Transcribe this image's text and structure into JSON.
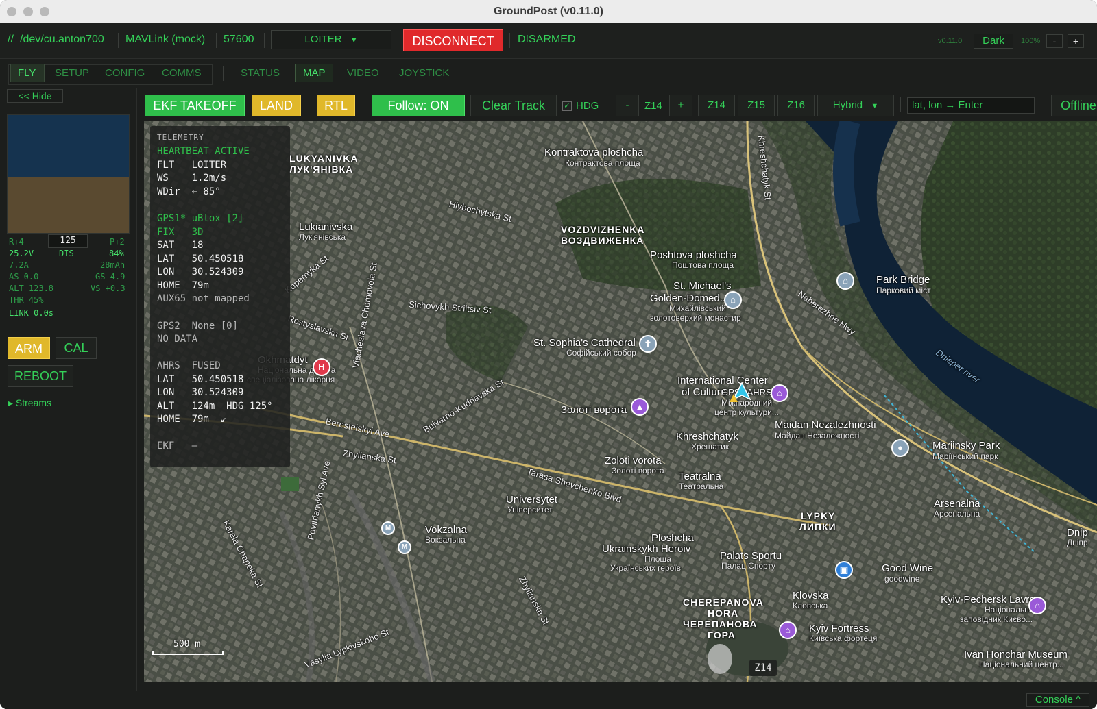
{
  "window": {
    "title": "GroundPost (v0.11.0)"
  },
  "connection": {
    "prefix": "//",
    "port": "/dev/cu.anton700",
    "protocol": "MAVLink (mock)",
    "baud": "57600",
    "flight_mode": "LOITER",
    "disconnect_label": "DISCONNECT",
    "arm_state": "DISARMED",
    "version": "v0.11.0",
    "theme": "Dark",
    "ui_zoom": "100%",
    "zoom_minus": "-",
    "zoom_plus": "+"
  },
  "tabs": {
    "primary": [
      "FLY",
      "SETUP",
      "CONFIG",
      "COMMS"
    ],
    "secondary": [
      "STATUS",
      "MAP",
      "VIDEO",
      "JOYSTICK"
    ],
    "active_primary": "FLY",
    "active_secondary": "MAP"
  },
  "left_panel": {
    "hide_label": "<< Hide",
    "roll": "R+4",
    "distance": "125",
    "pitch": "P+2",
    "voltage": "25.2V",
    "dis_label": "DIS",
    "battery_pct": "84%",
    "current": "7.2A",
    "consumed": "28mAh",
    "airspeed": "AS 0.0",
    "groundspeed": "GS 4.9",
    "altitude": "ALT 123.8",
    "vspeed": "VS +0.3",
    "throttle": "THR 45%",
    "link": "LINK  0.0s",
    "arm_label": "ARM",
    "cal_label": "CAL",
    "reboot_label": "REBOOT",
    "streams_label": "▸ Streams"
  },
  "toolbar": {
    "ekf_takeoff": "EKF TAKEOFF",
    "land": "LAND",
    "rtl": "RTL",
    "follow": "Follow: ON",
    "clear_track": "Clear Track",
    "hdg_label": "HDG",
    "hdg_checked": "✓",
    "zoom_minus": "-",
    "zoom_current": "Z14",
    "zoom_plus": "+",
    "z14": "Z14",
    "z15": "Z15",
    "z16": "Z16",
    "map_type": "Hybrid",
    "coord_placeholder": "lat, lon → Enter",
    "offline": "Offline"
  },
  "telemetry": {
    "header": "TELEMETRY",
    "heartbeat": "HEARTBEAT ACTIVE",
    "flt": "FLT   LOITER",
    "ws": "WS    1.2m/s",
    "wdir": "WDir  ← 85°",
    "gps1": "GPS1* uBlox [2]",
    "fix": "FIX   3D",
    "sat": "SAT   18",
    "lat": "LAT   50.450518",
    "lon": "LON   30.524309",
    "home": "HOME  79m",
    "aux": "AUX65 not mapped",
    "gps2": "GPS2  None [0]",
    "nodata": "NO DATA",
    "ahrs": "AHRS  FUSED",
    "ahrs_lat": "LAT   50.450518",
    "ahrs_lon": "LON   30.524309",
    "ahrs_alt": "ALT   124m  HDG 125°",
    "ahrs_home": "HOME  79m  ↙",
    "ekf": "EKF   –"
  },
  "map": {
    "scale": "500 m",
    "zoom_badge": "Z14",
    "labels": {
      "kontraktova": "Kontraktova ploshcha",
      "kontraktova_ua": "Контрактова площа",
      "vozdvyzhenka": "VOZDVIZHENKA",
      "vozdvyzhenka_ua": "ВОЗДВИЖЕНКА",
      "poshtova": "Poshtova ploshcha",
      "poshtova_ua": "Поштова площа",
      "park_bridge": "Park Bridge",
      "park_bridge_ua": "Парковий міст",
      "st_michael": "St. Michael's",
      "golden_domed": "Golden-Domed...",
      "st_michael_ua1": "Михайлівський",
      "st_michael_ua2": "золотоверхий монастир",
      "lukianivska": "Lukianivska",
      "lukianivska_ua": "Лук'янівська",
      "st_sophia": "St. Sophia's Cathedral",
      "st_sophia_ua": "Софійський собор",
      "okhmatdyt": "Okhmatdyt",
      "okhmatdyt_ua1": "Національна дитяча",
      "okhmatdyt_ua2": "спеціалізована лікарня",
      "intl_center1": "International Center",
      "intl_center2": "of Culture",
      "intl_center_ua1": "Міжнародний",
      "intl_center_ua2": "центр культури...",
      "zoloti_vorota_ua_big": "Золоті ворота",
      "maidan": "Maidan Nezalezhnosti",
      "maidan_ua": "Майдан Незалежності",
      "mariinsky": "Mariinsky Park",
      "mariinsky_ua": "Маріїнський парк",
      "khreshchatyk": "Khreshchatyk",
      "khreshchatyk_ua": "Хрещатик",
      "zoloti_vorota": "Zoloti vorota",
      "zoloti_vorota_ua": "Золоті ворота",
      "teatralna": "Teatralna",
      "teatralna_ua": "Театральна",
      "universytet": "Universytet",
      "universytet_ua": "Університет",
      "arsenalna": "Arsenalna",
      "arsenalna_ua": "Арсенальна",
      "lypky": "LYPKY",
      "lypky_ua": "ЛИПКИ",
      "vokzalna": "Vokzalna",
      "vokzalna_ua": "Вокзальна",
      "ploshcha": "Ploshcha",
      "ukrainskykh": "Ukrainskykh Heroiv",
      "ukrainskykh_ua1": "Площа",
      "ukrainskykh_ua2": "Українських героїв",
      "palats_sportu": "Palats Sportu",
      "palats_sportu_ua": "Палац Спорту",
      "good_wine": "Good Wine",
      "good_wine_sub": "goodwine",
      "klovska": "Klovska",
      "klovska_ua": "Кловська",
      "kyiv_pechersk": "Kyiv-Pechersk Lavra",
      "kyiv_pechersk_ua1": "Національний",
      "kyiv_pechersk_ua2": "заповідник Києво...",
      "cherepanova": "CHEREPANOVA",
      "hora": "HORA",
      "cherepanova_ua": "ЧЕРЕПАНОВА",
      "hora_ua": "ГОРА",
      "kyiv_fortress": "Kyiv Fortress",
      "kyiv_fortress_ua": "Київська фортеця",
      "ivan_honchar": "Ivan Honchar Museum",
      "ivan_honchar_ua": "Національний центр...",
      "dnieper": "Dnieper river",
      "dnip": "Dnip",
      "dnip_ua": "Дніпр",
      "hlybochytska": "Hlybochytska St",
      "khreshchatyk_st": "Khreshchatyk St",
      "naberezhne": "Naberezhne Hwy",
      "sichovykh": "Sichovykh Striltsiv St",
      "rostyslavska": "Rostyslavska St",
      "kopernyka": "Kopernyka St",
      "chornovola": "Viacheslava Chornovola St",
      "bulvarno": "Bulvarno-Kudriavska St",
      "beresteiskyi": "Beresteiskyi Ave",
      "zhylianska": "Zhylianska St",
      "tarasa": "Tarasa Shevchenko Blvd",
      "povitrianykh": "Povitrianykh Syl Ave",
      "karela": "Karela Chapeka St",
      "vasylia": "Vasylia Lypkivskoho St",
      "zhylianska2": "Zhylianska St",
      "lukianivka": "LUKYANIVKA",
      "lukianivka_ua": "ЛУК'ЯНІВКА",
      "gps_ahrs": "GPS1 AHRS"
    }
  },
  "bottom": {
    "console_label": "Console ^"
  },
  "colors": {
    "accent_green": "#34d058",
    "button_green": "#2fbf4b",
    "button_yellow": "#e0b82a",
    "disconnect_red": "#e0292b"
  }
}
